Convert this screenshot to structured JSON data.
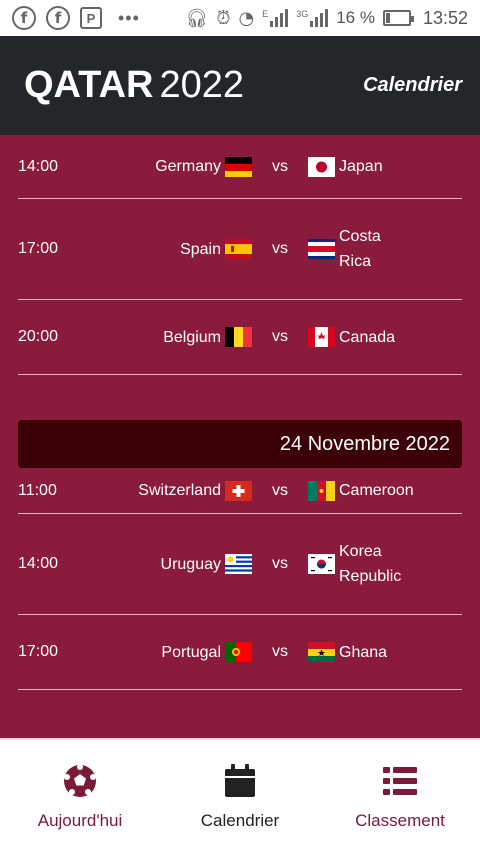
{
  "status_bar": {
    "battery": "16 %",
    "time": "13:52",
    "net_e": "E",
    "net_3g": "3G"
  },
  "header": {
    "title_bold": "QATAR",
    "title_light": "2022",
    "subtitle": "Calendrier"
  },
  "schedule": {
    "group1": [
      {
        "time": "14:00",
        "home": "Germany",
        "home_flag": "germany-flag",
        "vs": "vs",
        "away": "Japan",
        "away_flag": "japan-flag"
      },
      {
        "time": "17:00",
        "home": "Spain",
        "home_flag": "spain-flag",
        "vs": "vs",
        "away": "Costa Rica",
        "away_flag": "costa-rica-flag"
      },
      {
        "time": "20:00",
        "home": "Belgium",
        "home_flag": "belgium-flag",
        "vs": "vs",
        "away": "Canada",
        "away_flag": "canada-flag"
      }
    ],
    "date_header": "24 Novembre 2022",
    "group2": [
      {
        "time": "11:00",
        "home": "Switzerland",
        "home_flag": "switzerland-flag",
        "vs": "vs",
        "away": "Cameroon",
        "away_flag": "cameroon-flag"
      },
      {
        "time": "14:00",
        "home": "Uruguay",
        "home_flag": "uruguay-flag",
        "vs": "vs",
        "away": "Korea Republic",
        "away_flag": "korea-flag"
      },
      {
        "time": "17:00",
        "home": "Portugal",
        "home_flag": "portugal-flag",
        "vs": "vs",
        "away": "Ghana",
        "away_flag": "ghana-flag"
      }
    ]
  },
  "bottom_nav": [
    {
      "label": "Aujourd'hui",
      "icon": "soccer-ball-icon",
      "active": false
    },
    {
      "label": "Calendrier",
      "icon": "calendar-icon",
      "active": true
    },
    {
      "label": "Classement",
      "icon": "list-icon",
      "active": false
    }
  ],
  "colors": {
    "background": "#8a1b3d",
    "header": "#23272b",
    "date_bar": "#3b0008",
    "accent": "#7a1a36"
  }
}
